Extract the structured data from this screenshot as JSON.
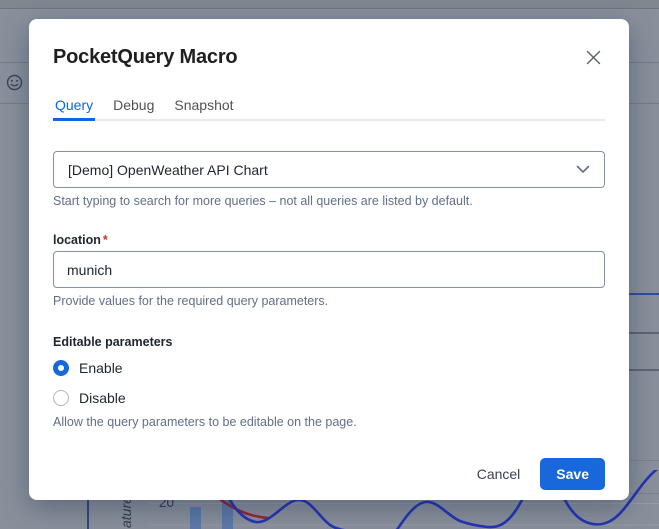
{
  "colors": {
    "accent_blue": "#0C66E4",
    "save_blue": "#1868DB",
    "required_red": "#C9372C",
    "helper_gray": "#626F86",
    "overlay_gray": "#8A909B",
    "chart_bar_blue": "#5D7AA8",
    "chart_line_blue": "#2535B5",
    "chart_line_red": "#9E2430"
  },
  "modal": {
    "title": "PocketQuery Macro",
    "close_icon": "close-x",
    "tabs": [
      {
        "label": "Query",
        "active": true
      },
      {
        "label": "Debug",
        "active": false
      },
      {
        "label": "Snapshot",
        "active": false
      }
    ],
    "query_select": {
      "value": "[Demo] OpenWeather API Chart",
      "helper": "Start typing to search for more queries – not all queries are listed by default."
    },
    "location_field": {
      "label": "location",
      "required_marker": "*",
      "value": "munich",
      "helper": "Provide values for the required query parameters."
    },
    "editable_parameters": {
      "label": "Editable parameters",
      "options": [
        {
          "label": "Enable",
          "selected": true
        },
        {
          "label": "Disable",
          "selected": false
        }
      ],
      "helper": "Allow the query parameters to be editable on the page."
    },
    "actions": {
      "cancel": "Cancel",
      "save": "Save"
    }
  },
  "background": {
    "toolbar_icon": "smiley-emoji",
    "chart_fragment": {
      "y_axis_label_partial": "ature",
      "y_tick": "20"
    }
  }
}
